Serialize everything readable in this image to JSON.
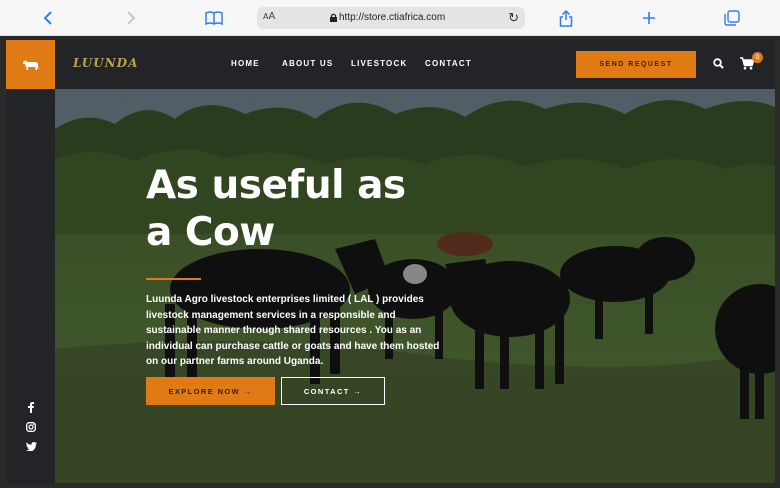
{
  "browser": {
    "text_size_label": "AA",
    "url": "http://store.ctiafrica.com"
  },
  "site": {
    "brand": "LUUNDA",
    "nav": [
      {
        "label": "HOME"
      },
      {
        "label": "ABOUT US"
      },
      {
        "label": "LIVESTOCK"
      },
      {
        "label": "CONTACT"
      }
    ],
    "send_request_label": "SEND REQUEST",
    "cart_count": "0"
  },
  "hero": {
    "title_line1": "As useful as",
    "title_line2": "a Cow",
    "description": "Luunda Agro livestock enterprises limited ( LAL ) provides livestock management services in a responsible and sustainable manner through shared resources . You as an individual can purchase cattle or goats and have them hosted on our partner farms around Uganda.",
    "explore_label": "EXPLORE NOW →",
    "contact_label": "CONTACT →"
  },
  "icons": {
    "back": "chevron-left-icon",
    "forward": "chevron-right-icon",
    "bookmarks": "book-icon",
    "lock": "lock-icon",
    "reload": "reload-icon",
    "share": "share-icon",
    "new_tab": "plus-icon",
    "tabs": "tabs-icon",
    "logo": "cow-icon",
    "search": "search-icon",
    "cart": "cart-icon",
    "facebook": "facebook-icon",
    "instagram": "instagram-icon",
    "twitter": "twitter-icon"
  },
  "colors": {
    "accent": "#e07a14",
    "dark": "#232427",
    "safari_blue": "#2f7df6"
  }
}
